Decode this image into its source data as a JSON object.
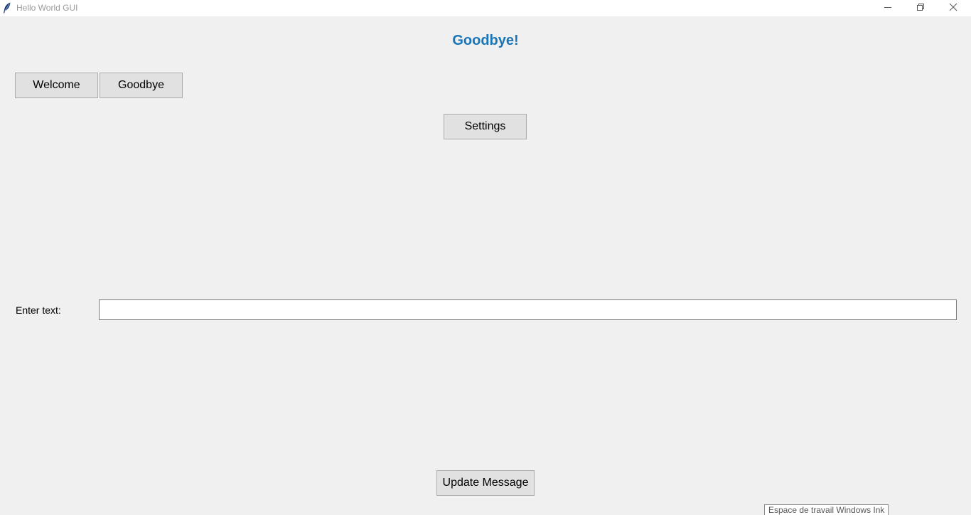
{
  "window": {
    "title": "Hello World GUI",
    "controls": {
      "minimize_icon": "minimize-icon",
      "maximize_icon": "restore-icon",
      "close_icon": "close-icon"
    }
  },
  "main": {
    "heading": "Goodbye!",
    "heading_color": "#1a76b8",
    "welcome_button": "Welcome",
    "goodbye_button": "Goodbye",
    "settings_button": "Settings",
    "input_label": "Enter text:",
    "input_value": "",
    "input_placeholder": "",
    "update_button": "Update Message"
  },
  "tooltip": {
    "text": "Espace de travail Windows Ink"
  }
}
